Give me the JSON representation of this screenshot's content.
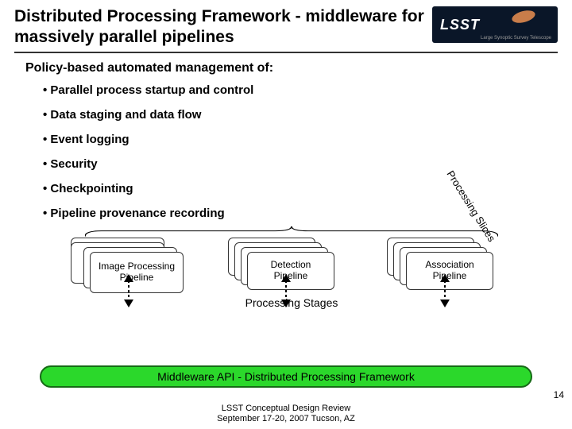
{
  "title": "Distributed Processing Framework - middleware for massively parallel pipelines",
  "logo": {
    "main": "LSST",
    "sub": "Large Synoptic Survey Telescope"
  },
  "lead": "Policy-based automated management of:",
  "bullets": [
    "Parallel process startup and control",
    "Data staging and data flow",
    "Event logging",
    "Security",
    "Checkpointing",
    "Pipeline provenance recording"
  ],
  "diagram": {
    "stack1": "Image Processing Pipeline",
    "stack2": "Detection Pipeline",
    "stack3": "Association Pipeline",
    "slices_label": "Processing Slices",
    "stages_label": "Processing Stages",
    "api_label": "Middleware API - Distributed Processing Framework"
  },
  "page_number": "14",
  "footer": {
    "line1": "LSST Conceptual Design Review",
    "line2": "September 17-20, 2007 Tucson, AZ"
  }
}
